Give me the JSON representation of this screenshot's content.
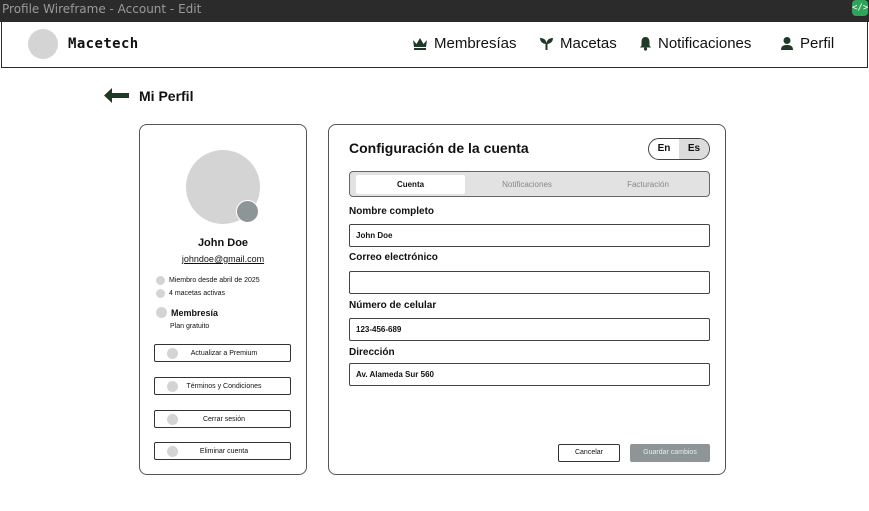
{
  "window": {
    "title": "Profile Wireframe - Account - Edit"
  },
  "navbar": {
    "brand": "Macetech",
    "items": [
      {
        "label": "Membresías",
        "icon": "crown-icon"
      },
      {
        "label": "Macetas",
        "icon": "plant-icon"
      },
      {
        "label": "Notificaciones",
        "icon": "bell-icon"
      },
      {
        "label": "Perfil",
        "icon": "user-icon"
      }
    ]
  },
  "page": {
    "title": "Mi Perfil"
  },
  "profile": {
    "name": "John Doe",
    "email": "johndoe@gmail.com",
    "meta": [
      "Miembro desde abril de 2025",
      "4 macetas activas"
    ],
    "membership_label": "Membresía",
    "plan": "Plan gratuito",
    "actions": [
      "Actualizar a Premium",
      "Términos y Condiciones",
      "Cerrar sesión",
      "Eliminar cuenta"
    ]
  },
  "settings": {
    "title": "Configuración de la cuenta",
    "languages": [
      "En",
      "Es"
    ],
    "active_language": "Es",
    "tabs": [
      "Cuenta",
      "Notificaciones",
      "Facturación"
    ],
    "active_tab": "Cuenta",
    "fields": [
      {
        "label": "Nombre completo",
        "value": "John Doe"
      },
      {
        "label": "Correo electrónico",
        "value": ""
      },
      {
        "label": "Número de celular",
        "value": "123-456-689"
      },
      {
        "label": "Dirección",
        "value": "Av. Alameda Sur 560"
      }
    ],
    "cancel_label": "Cancelar",
    "save_label": "Guardar cambios"
  },
  "colors": {
    "accent_dark": "#1e3a26",
    "disabled_button": "#8d9596"
  }
}
